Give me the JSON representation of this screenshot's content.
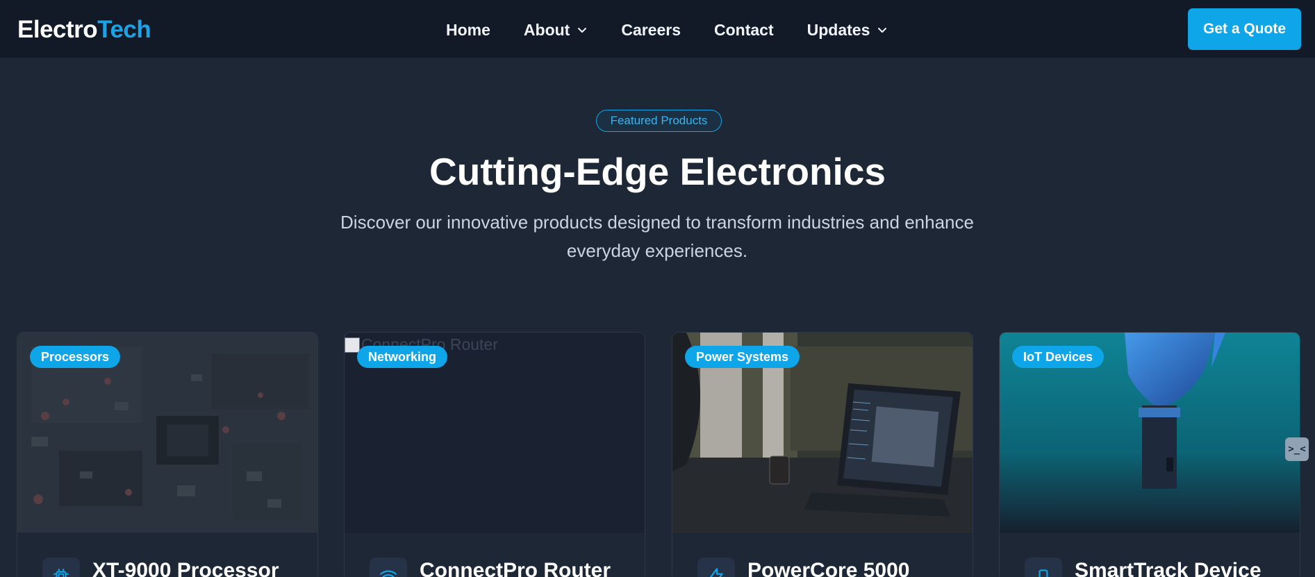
{
  "nav": {
    "logo_part1": "Electro",
    "logo_part2": "Tech",
    "links": [
      {
        "label": "Home",
        "dropdown": false
      },
      {
        "label": "About",
        "dropdown": true
      },
      {
        "label": "Careers",
        "dropdown": false
      },
      {
        "label": "Contact",
        "dropdown": false
      },
      {
        "label": "Updates",
        "dropdown": true
      }
    ],
    "cta_label": "Get a Quote"
  },
  "hero": {
    "badge": "Featured Products",
    "title": "Cutting-Edge Electronics",
    "subtitle": "Discover our innovative products designed to transform industries and enhance everyday experiences."
  },
  "products": [
    {
      "category": "Processors",
      "name": "XT-9000 Processor",
      "icon": "chip-icon",
      "image": "circuit-board"
    },
    {
      "category": "Networking",
      "name": "ConnectPro Router",
      "icon": "wifi-icon",
      "image_alt": "ConnectPro Router",
      "image": "broken"
    },
    {
      "category": "Power Systems",
      "name": "PowerCore 5000",
      "icon": "lightning-icon",
      "image": "laptop-desk"
    },
    {
      "category": "IoT Devices",
      "name": "SmartTrack Device",
      "icon": "device-icon",
      "image": "robot-hand"
    }
  ],
  "widget": {
    "label": ">_<"
  },
  "colors": {
    "accent": "#0ea5e9",
    "nav_bg": "#121a28",
    "page_bg": "#1e2736",
    "card_bg": "#1a2232"
  }
}
